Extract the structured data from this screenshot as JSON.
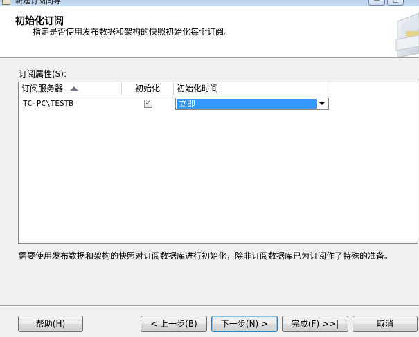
{
  "window": {
    "title": "新建订阅向导",
    "minimize": "—",
    "maximize": "□"
  },
  "header": {
    "title": "初始化订阅",
    "subtitle": "指定是否使用发布数据和架构的快照初始化每个订阅。"
  },
  "grid": {
    "label": "订阅属性(S):",
    "columns": [
      "订阅服务器",
      "初始化",
      "初始化时间"
    ],
    "sort_column": "订阅服务器",
    "sort_direction": "ascending",
    "rows": [
      {
        "server": "TC-PC\\TESTB",
        "initialize": true,
        "check_glyph": "✓",
        "init_time": "立即"
      }
    ]
  },
  "description": "需要使用发布数据和架构的快照对订阅数据库进行初始化，除非订阅数据库已为订阅作了特殊的准备。",
  "buttons": {
    "help": "帮助(H)",
    "back": "< 上一步(B)",
    "next": "下一步(N) >",
    "finish": "完成(F) >>|",
    "cancel": "取消"
  },
  "colors": {
    "selection": "#3399ff",
    "header_bg": "#ffffff",
    "dialog_bg": "#f0f0f0"
  }
}
